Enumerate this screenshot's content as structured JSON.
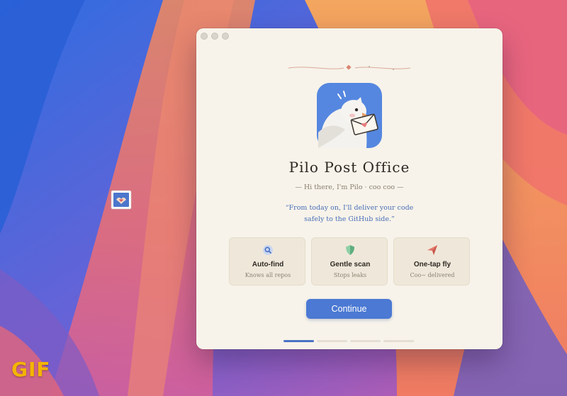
{
  "desktop": {
    "badge_text": "GIF",
    "stamp_icon": "stamp-icon"
  },
  "window": {
    "controls": [
      "close",
      "minimize",
      "zoom"
    ]
  },
  "welcome": {
    "app_name": "Pilo Post Office",
    "greeting": "— Hi there, I'm Pilo · coo coo —",
    "quote_line1": "“From today on, I'll deliver your code",
    "quote_line2": "safely to the GitHub side.”",
    "icon": "pigeon-with-letter-icon"
  },
  "features": [
    {
      "title": "Auto-find",
      "subtitle": "Knows all repos",
      "icon": "magnifier-icon",
      "color": "#5b7fcf"
    },
    {
      "title": "Gentle scan",
      "subtitle": "Stops leaks",
      "icon": "shield-icon",
      "color": "#6dbb8a"
    },
    {
      "title": "One-tap fly",
      "subtitle": "Coo~ delivered",
      "icon": "paper-plane-icon",
      "color": "#e06a5a"
    }
  ],
  "continue_label": "Continue",
  "progress": {
    "total_steps": 4,
    "current_step": 1
  },
  "colors": {
    "window_bg": "#f7f3ea",
    "accent": "#4b79d3",
    "card_bg": "#efe8da"
  }
}
